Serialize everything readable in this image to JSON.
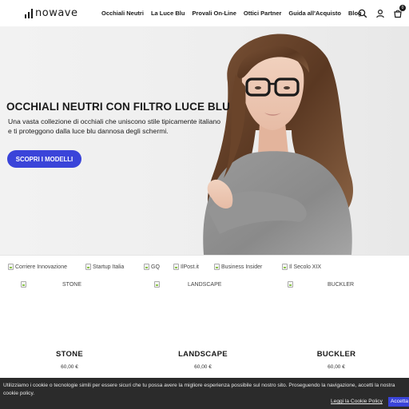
{
  "brand": {
    "name": "nowave"
  },
  "nav": {
    "items": [
      {
        "label": "Occhiali Neutri"
      },
      {
        "label": "La Luce Blu"
      },
      {
        "label": "Provali On-Line"
      },
      {
        "label": "Ottici Partner"
      },
      {
        "label": "Guida all'Acquisto"
      },
      {
        "label": "Blog"
      }
    ]
  },
  "header": {
    "icons": [
      "search-icon",
      "user-icon",
      "cart-icon"
    ],
    "cart_count": "0"
  },
  "hero": {
    "title": "OCCHIALI NEUTRI CON FILTRO LUCE BLU",
    "text": "Una vasta collezione di occhiali che uniscono stile tipicamente italiano e ti proteggono dalla luce blu dannosa degli schermi.",
    "cta_label": "SCOPRI I MODELLI",
    "accent_color": "#3a44d9"
  },
  "press": [
    {
      "alt": "Corriere Innovazione"
    },
    {
      "alt": "Startup Italia"
    },
    {
      "alt": "GQ"
    },
    {
      "alt": "IlPost.it"
    },
    {
      "alt": "Business Insider"
    },
    {
      "alt": "Il Secolo XIX"
    }
  ],
  "products": [
    {
      "image_alt": "STONE",
      "name": "STONE",
      "price": "60,00 €"
    },
    {
      "image_alt": "LANDSCAPE",
      "name": "LANDSCAPE",
      "price": "60,00 €"
    },
    {
      "image_alt": "BUCKLER",
      "name": "BUCKLER",
      "price": "60,00 €"
    }
  ],
  "cookie": {
    "text": "Utilizziamo i cookie o tecnologie simili per essere sicuri che tu possa avere la migliore esperienza possibile sul nostro sito. Proseguendo la navigazione, accetti la nostra cookie policy.",
    "policy_link": "Leggi la Cookie Policy",
    "accept_label": "Accetta"
  }
}
